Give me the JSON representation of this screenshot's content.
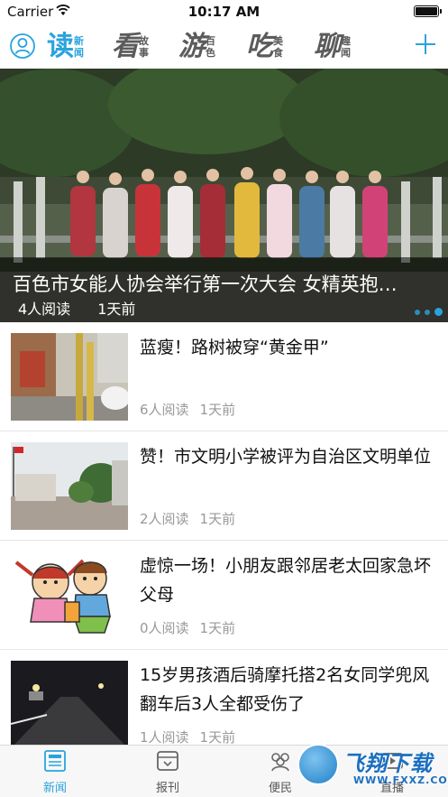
{
  "status_bar": {
    "carrier": "Carrier",
    "time": "10:17 AM"
  },
  "nav": {
    "tabs": [
      {
        "big": "读",
        "small1": "新",
        "small2": "闻",
        "active": true
      },
      {
        "big": "看",
        "small1": "故",
        "small2": "事",
        "active": false
      },
      {
        "big": "游",
        "small1": "百",
        "small2": "色",
        "active": false
      },
      {
        "big": "吃",
        "small1": "美",
        "small2": "食",
        "active": false
      },
      {
        "big": "聊",
        "small1": "趣",
        "small2": "闻",
        "active": false
      }
    ]
  },
  "banner": {
    "title": "百色市女能人协会举行第一次大会 女精英抱…",
    "reads": "4人阅读",
    "time": "1天前",
    "slides": 3,
    "active_slide": 3
  },
  "news": [
    {
      "title": "蓝瘦！路树被穿“黄金甲”",
      "reads": "6人阅读",
      "time": "1天前"
    },
    {
      "title": "赞！市文明小学被评为自治区文明单位",
      "reads": "2人阅读",
      "time": "1天前"
    },
    {
      "title": "虚惊一场！小朋友跟邻居老太回家急坏父母",
      "reads": "0人阅读",
      "time": "1天前"
    },
    {
      "title": "15岁男孩酒后骑摩托搭2名女同学兜风 翻车后3人全都受伤了",
      "reads": "1人阅读",
      "time": "1天前"
    }
  ],
  "tabbar": {
    "items": [
      {
        "label": "新闻",
        "active": true
      },
      {
        "label": "报刊",
        "active": false
      },
      {
        "label": "便民",
        "active": false
      },
      {
        "label": "直播",
        "active": false
      }
    ]
  },
  "watermark": {
    "text": "飞翔下载",
    "url": "WWW.FXXZ.COM"
  },
  "colors": {
    "accent": "#2aa3dd",
    "muted": "#999999"
  }
}
